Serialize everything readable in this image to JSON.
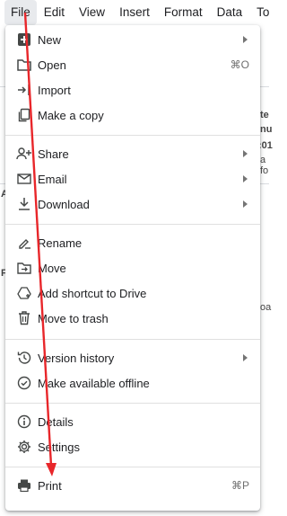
{
  "menubar": [
    "File",
    "Edit",
    "View",
    "Insert",
    "Format",
    "Data",
    "Tools"
  ],
  "background_fragments": [
    "te",
    "nu",
    ":01",
    "a fo",
    "A",
    "F",
    "oa"
  ],
  "menu": {
    "items": [
      {
        "label": "New",
        "icon": "plus-box-icon",
        "submenu": true,
        "shortcut": ""
      },
      {
        "label": "Open",
        "icon": "folder-icon",
        "submenu": false,
        "shortcut": "⌘O"
      },
      {
        "label": "Import",
        "icon": "import-icon",
        "submenu": false,
        "shortcut": ""
      },
      {
        "label": "Make a copy",
        "icon": "copy-icon",
        "submenu": false,
        "shortcut": ""
      },
      {
        "label": "Share",
        "icon": "person-add-icon",
        "submenu": true,
        "shortcut": ""
      },
      {
        "label": "Email",
        "icon": "mail-icon",
        "submenu": true,
        "shortcut": ""
      },
      {
        "label": "Download",
        "icon": "download-icon",
        "submenu": true,
        "shortcut": ""
      },
      {
        "label": "Rename",
        "icon": "rename-icon",
        "submenu": false,
        "shortcut": ""
      },
      {
        "label": "Move",
        "icon": "move-folder-icon",
        "submenu": false,
        "shortcut": ""
      },
      {
        "label": "Add shortcut to Drive",
        "icon": "drive-shortcut-icon",
        "submenu": false,
        "shortcut": ""
      },
      {
        "label": "Move to trash",
        "icon": "trash-icon",
        "submenu": false,
        "shortcut": ""
      },
      {
        "label": "Version history",
        "icon": "history-icon",
        "submenu": true,
        "shortcut": ""
      },
      {
        "label": "Make available offline",
        "icon": "offline-check-icon",
        "submenu": false,
        "shortcut": ""
      },
      {
        "label": "Details",
        "icon": "info-icon",
        "submenu": false,
        "shortcut": ""
      },
      {
        "label": "Settings",
        "icon": "gear-icon",
        "submenu": false,
        "shortcut": ""
      },
      {
        "label": "Print",
        "icon": "printer-icon",
        "submenu": false,
        "shortcut": "⌘P"
      }
    ]
  },
  "annotation": {
    "color": "#e8262a"
  }
}
